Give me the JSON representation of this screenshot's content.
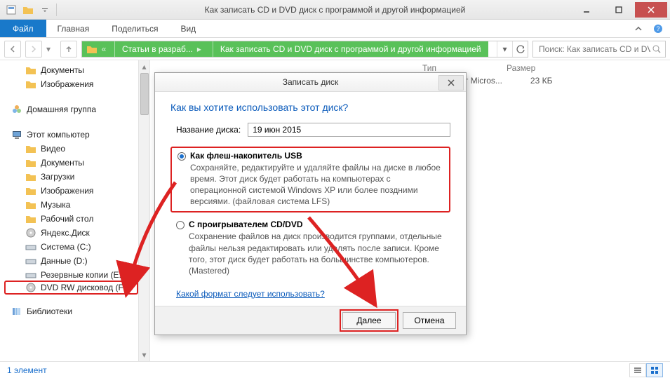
{
  "titlebar": {
    "title": "Как записать CD и DVD диск с программой и другой информацией"
  },
  "ribbon": {
    "file": "Файл",
    "tabs": [
      "Главная",
      "Поделиться",
      "Вид"
    ]
  },
  "nav": {
    "breadcrumb": {
      "seg1": "Статьи в разраб...",
      "seg2": "Как записать CD и DVD диск с программой и другой информацией"
    },
    "search_placeholder": "Поиск: Как записать CD и DV..."
  },
  "columns": {
    "type": "Тип",
    "size": "Размер"
  },
  "filerow": {
    "type": "Документ Micros...",
    "size": "23 КБ"
  },
  "tree": {
    "documents": "Документы",
    "pictures": "Изображения",
    "homegroup": "Домашняя группа",
    "thispc": "Этот компьютер",
    "video": "Видео",
    "documents2": "Документы",
    "downloads": "Загрузки",
    "pictures2": "Изображения",
    "music": "Музыка",
    "desktop": "Рабочий стол",
    "yadisk": "Яндекс.Диск",
    "cdrive": "Система (C:)",
    "ddrive": "Данные (D:)",
    "edrive": "Резервные копии (E:)",
    "dvd": "DVD RW дисковод (F:)",
    "libraries": "Библиотеки"
  },
  "status": {
    "count": "1 элемент"
  },
  "modal": {
    "title": "Записать диск",
    "heading": "Как вы хотите использовать этот диск?",
    "name_label": "Название диска:",
    "name_value": "19 июн 2015",
    "opt1_title": "Как флеш-накопитель USB",
    "opt1_desc": "Сохраняйте, редактируйте и удаляйте файлы на диске в любое время. Этот диск будет работать на компьютерах с операционной системой Windows XP или более поздними версиями. (файловая система LFS)",
    "opt2_title": "С проигрывателем CD/DVD",
    "opt2_desc": "Сохранение файлов на диск производится группами, отдельные файлы нельзя редактировать или удалять после записи. Кроме того, этот диск будет работать на большинстве компьютеров. (Mastered)",
    "help_link": "Какой формат следует использовать?",
    "next": "Далее",
    "cancel": "Отмена"
  }
}
